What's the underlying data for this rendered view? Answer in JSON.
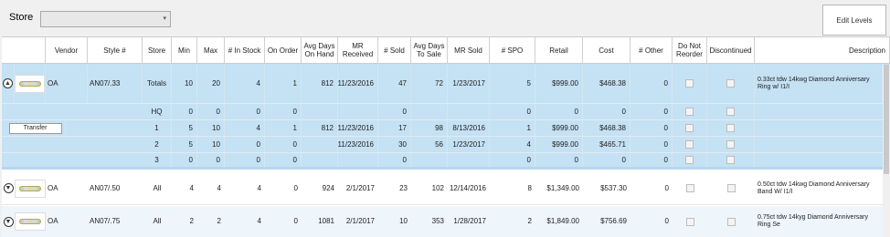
{
  "toolbar": {
    "store_label": "Store",
    "store_value": "",
    "edit_levels_label": "Edit Levels"
  },
  "columns": {
    "vendor": "Vendor",
    "style": "Style #",
    "store": "Store",
    "min": "Min",
    "max": "Max",
    "in_stock": "# In Stock",
    "on_order": "On Order",
    "avg_days_on_hand": "Avg Days On Hand",
    "mr_received": "MR Received",
    "sold": "# Sold",
    "avg_days_to_sale": "Avg Days To Sale",
    "mr_sold": "MR Sold",
    "spo": "# SPO",
    "retail": "Retail",
    "cost": "Cost",
    "other": "# Other",
    "do_not_reorder": "Do Not Reorder",
    "discontinued": "Discontinued",
    "description": "Description"
  },
  "expanded": {
    "totals": {
      "vendor": "OA",
      "style": "AN07/.33",
      "store": "Totals",
      "min": "10",
      "max": "20",
      "in_stock": "4",
      "on_order": "1",
      "avg_days_on_hand": "812",
      "mr_received": "11/23/2016",
      "sold": "47",
      "avg_days_to_sale": "72",
      "mr_sold": "1/23/2017",
      "spo": "5",
      "retail": "$999.00",
      "cost": "$468.38",
      "other": "0",
      "description": "0.33ct tdw 14kwg Diamond Anniversary Ring w/ I1/I"
    },
    "stores": [
      {
        "store": "HQ",
        "min": "0",
        "max": "0",
        "in_stock": "0",
        "on_order": "0",
        "avg_days_on_hand": "",
        "mr_received": "",
        "sold": "0",
        "avg_days_to_sale": "",
        "mr_sold": "",
        "spo": "0",
        "retail": "0",
        "cost": "0",
        "other": "0"
      },
      {
        "store": "1",
        "min": "5",
        "max": "10",
        "in_stock": "4",
        "on_order": "1",
        "avg_days_on_hand": "812",
        "mr_received": "11/23/2016",
        "sold": "17",
        "avg_days_to_sale": "98",
        "mr_sold": "8/13/2016",
        "spo": "1",
        "retail": "$999.00",
        "cost": "$468.38",
        "other": "0"
      },
      {
        "store": "2",
        "min": "5",
        "max": "10",
        "in_stock": "0",
        "on_order": "0",
        "avg_days_on_hand": "",
        "mr_received": "11/23/2016",
        "sold": "30",
        "avg_days_to_sale": "56",
        "mr_sold": "1/23/2017",
        "spo": "4",
        "retail": "$999.00",
        "cost": "$465.71",
        "other": "0"
      },
      {
        "store": "3",
        "min": "0",
        "max": "0",
        "in_stock": "0",
        "on_order": "0",
        "avg_days_on_hand": "",
        "mr_received": "",
        "sold": "0",
        "avg_days_to_sale": "",
        "mr_sold": "",
        "spo": "0",
        "retail": "0",
        "cost": "0",
        "other": "0"
      }
    ],
    "transfer_label": "Transfer"
  },
  "products": [
    {
      "vendor": "OA",
      "style": "AN07/.50",
      "store": "All",
      "min": "4",
      "max": "4",
      "in_stock": "4",
      "on_order": "0",
      "avg_days_on_hand": "924",
      "mr_received": "2/1/2017",
      "sold": "23",
      "avg_days_to_sale": "102",
      "mr_sold": "12/14/2016",
      "spo": "8",
      "retail": "$1,349.00",
      "cost": "$537.30",
      "other": "0",
      "description": "0.50ct tdw 14kwg Diamond Anniversary Band W/ I1/I"
    },
    {
      "vendor": "OA",
      "style": "AN07/.75",
      "store": "All",
      "min": "2",
      "max": "2",
      "in_stock": "4",
      "on_order": "0",
      "avg_days_on_hand": "1081",
      "mr_received": "2/1/2017",
      "sold": "10",
      "avg_days_to_sale": "353",
      "mr_sold": "1/28/2017",
      "spo": "2",
      "retail": "$1,849.00",
      "cost": "$756.69",
      "other": "0",
      "description": "0.75ct tdw 14kyg Diamond Anniversary Ring Se"
    }
  ],
  "icons": {
    "expand_up": "▲",
    "expand_down": "▼",
    "chevron": "▾"
  }
}
